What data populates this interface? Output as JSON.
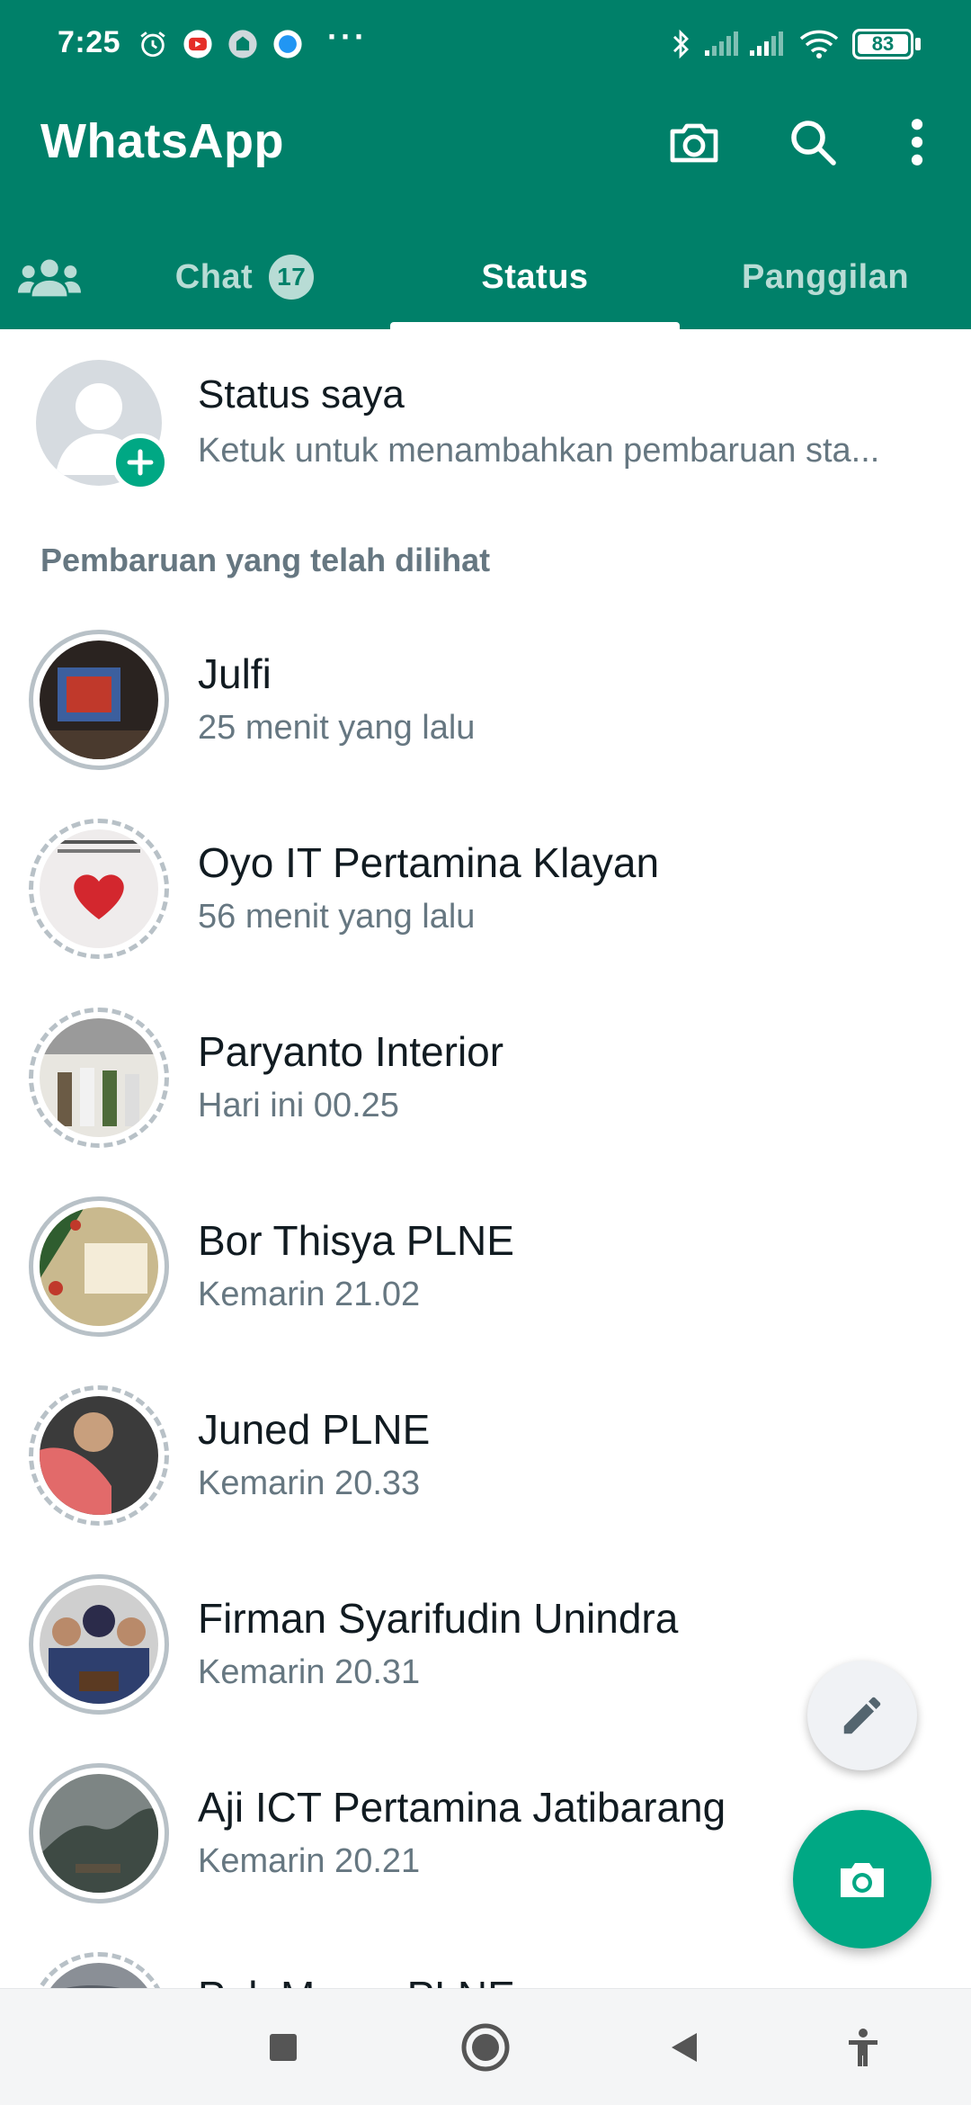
{
  "status_bar": {
    "time": "7:25",
    "battery": "83",
    "more": "···"
  },
  "header": {
    "app_title": "WhatsApp",
    "background_color": "#008069"
  },
  "tabs": [
    {
      "label": "Chat",
      "badge": "17",
      "active": false
    },
    {
      "label": "Status",
      "badge": "",
      "active": true
    },
    {
      "label": "Panggilan",
      "badge": "",
      "active": false
    }
  ],
  "my_status": {
    "title": "Status saya",
    "subtitle": "Ketuk untuk menambahkan pembaruan sta..."
  },
  "section_label": "Pembaruan yang telah dilihat",
  "statuses": [
    {
      "name": "Julfi",
      "time": "25 menit yang lalu"
    },
    {
      "name": "Oyo IT Pertamina Klayan",
      "time": "56 menit yang lalu"
    },
    {
      "name": "Paryanto Interior",
      "time": "Hari ini 00.25"
    },
    {
      "name": "Bor Thisya PLNE",
      "time": "Kemarin 21.02"
    },
    {
      "name": "Juned PLNE",
      "time": "Kemarin 20.33"
    },
    {
      "name": "Firman Syarifudin Unindra",
      "time": "Kemarin 20.31"
    },
    {
      "name": "Aji ICT Pertamina Jatibarang",
      "time": "Kemarin 20.21"
    },
    {
      "name": "Pak Mumu PLNE",
      "time": ""
    }
  ],
  "colors": {
    "accent": "#00a884",
    "ring_viewed": "#b8c1c7"
  },
  "icons": {
    "camera": "camera-icon",
    "search": "search-icon",
    "menu": "more-vert-icon",
    "community": "community-icon",
    "edit": "pencil-icon"
  }
}
